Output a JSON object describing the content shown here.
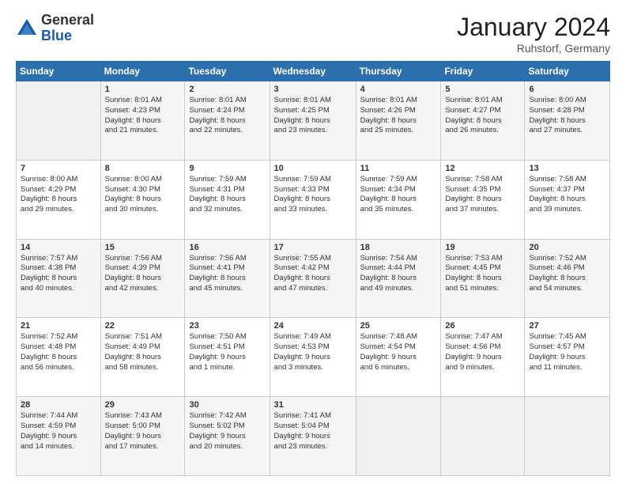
{
  "logo": {
    "general": "General",
    "blue": "Blue"
  },
  "title": "January 2024",
  "location": "Ruhstorf, Germany",
  "days_of_week": [
    "Sunday",
    "Monday",
    "Tuesday",
    "Wednesday",
    "Thursday",
    "Friday",
    "Saturday"
  ],
  "weeks": [
    [
      {
        "day": "",
        "info": ""
      },
      {
        "day": "1",
        "info": "Sunrise: 8:01 AM\nSunset: 4:23 PM\nDaylight: 8 hours\nand 21 minutes."
      },
      {
        "day": "2",
        "info": "Sunrise: 8:01 AM\nSunset: 4:24 PM\nDaylight: 8 hours\nand 22 minutes."
      },
      {
        "day": "3",
        "info": "Sunrise: 8:01 AM\nSunset: 4:25 PM\nDaylight: 8 hours\nand 23 minutes."
      },
      {
        "day": "4",
        "info": "Sunrise: 8:01 AM\nSunset: 4:26 PM\nDaylight: 8 hours\nand 25 minutes."
      },
      {
        "day": "5",
        "info": "Sunrise: 8:01 AM\nSunset: 4:27 PM\nDaylight: 8 hours\nand 26 minutes."
      },
      {
        "day": "6",
        "info": "Sunrise: 8:00 AM\nSunset: 4:28 PM\nDaylight: 8 hours\nand 27 minutes."
      }
    ],
    [
      {
        "day": "7",
        "info": "Sunrise: 8:00 AM\nSunset: 4:29 PM\nDaylight: 8 hours\nand 29 minutes."
      },
      {
        "day": "8",
        "info": "Sunrise: 8:00 AM\nSunset: 4:30 PM\nDaylight: 8 hours\nand 30 minutes."
      },
      {
        "day": "9",
        "info": "Sunrise: 7:59 AM\nSunset: 4:31 PM\nDaylight: 8 hours\nand 32 minutes."
      },
      {
        "day": "10",
        "info": "Sunrise: 7:59 AM\nSunset: 4:33 PM\nDaylight: 8 hours\nand 33 minutes."
      },
      {
        "day": "11",
        "info": "Sunrise: 7:59 AM\nSunset: 4:34 PM\nDaylight: 8 hours\nand 35 minutes."
      },
      {
        "day": "12",
        "info": "Sunrise: 7:58 AM\nSunset: 4:35 PM\nDaylight: 8 hours\nand 37 minutes."
      },
      {
        "day": "13",
        "info": "Sunrise: 7:58 AM\nSunset: 4:37 PM\nDaylight: 8 hours\nand 39 minutes."
      }
    ],
    [
      {
        "day": "14",
        "info": "Sunrise: 7:57 AM\nSunset: 4:38 PM\nDaylight: 8 hours\nand 40 minutes."
      },
      {
        "day": "15",
        "info": "Sunrise: 7:56 AM\nSunset: 4:39 PM\nDaylight: 8 hours\nand 42 minutes."
      },
      {
        "day": "16",
        "info": "Sunrise: 7:56 AM\nSunset: 4:41 PM\nDaylight: 8 hours\nand 45 minutes."
      },
      {
        "day": "17",
        "info": "Sunrise: 7:55 AM\nSunset: 4:42 PM\nDaylight: 8 hours\nand 47 minutes."
      },
      {
        "day": "18",
        "info": "Sunrise: 7:54 AM\nSunset: 4:44 PM\nDaylight: 8 hours\nand 49 minutes."
      },
      {
        "day": "19",
        "info": "Sunrise: 7:53 AM\nSunset: 4:45 PM\nDaylight: 8 hours\nand 51 minutes."
      },
      {
        "day": "20",
        "info": "Sunrise: 7:52 AM\nSunset: 4:46 PM\nDaylight: 8 hours\nand 54 minutes."
      }
    ],
    [
      {
        "day": "21",
        "info": "Sunrise: 7:52 AM\nSunset: 4:48 PM\nDaylight: 8 hours\nand 56 minutes."
      },
      {
        "day": "22",
        "info": "Sunrise: 7:51 AM\nSunset: 4:49 PM\nDaylight: 8 hours\nand 58 minutes."
      },
      {
        "day": "23",
        "info": "Sunrise: 7:50 AM\nSunset: 4:51 PM\nDaylight: 9 hours\nand 1 minute."
      },
      {
        "day": "24",
        "info": "Sunrise: 7:49 AM\nSunset: 4:53 PM\nDaylight: 9 hours\nand 3 minutes."
      },
      {
        "day": "25",
        "info": "Sunrise: 7:48 AM\nSunset: 4:54 PM\nDaylight: 9 hours\nand 6 minutes."
      },
      {
        "day": "26",
        "info": "Sunrise: 7:47 AM\nSunset: 4:56 PM\nDaylight: 9 hours\nand 9 minutes."
      },
      {
        "day": "27",
        "info": "Sunrise: 7:45 AM\nSunset: 4:57 PM\nDaylight: 9 hours\nand 11 minutes."
      }
    ],
    [
      {
        "day": "28",
        "info": "Sunrise: 7:44 AM\nSunset: 4:59 PM\nDaylight: 9 hours\nand 14 minutes."
      },
      {
        "day": "29",
        "info": "Sunrise: 7:43 AM\nSunset: 5:00 PM\nDaylight: 9 hours\nand 17 minutes."
      },
      {
        "day": "30",
        "info": "Sunrise: 7:42 AM\nSunset: 5:02 PM\nDaylight: 9 hours\nand 20 minutes."
      },
      {
        "day": "31",
        "info": "Sunrise: 7:41 AM\nSunset: 5:04 PM\nDaylight: 9 hours\nand 23 minutes."
      },
      {
        "day": "",
        "info": ""
      },
      {
        "day": "",
        "info": ""
      },
      {
        "day": "",
        "info": ""
      }
    ]
  ]
}
